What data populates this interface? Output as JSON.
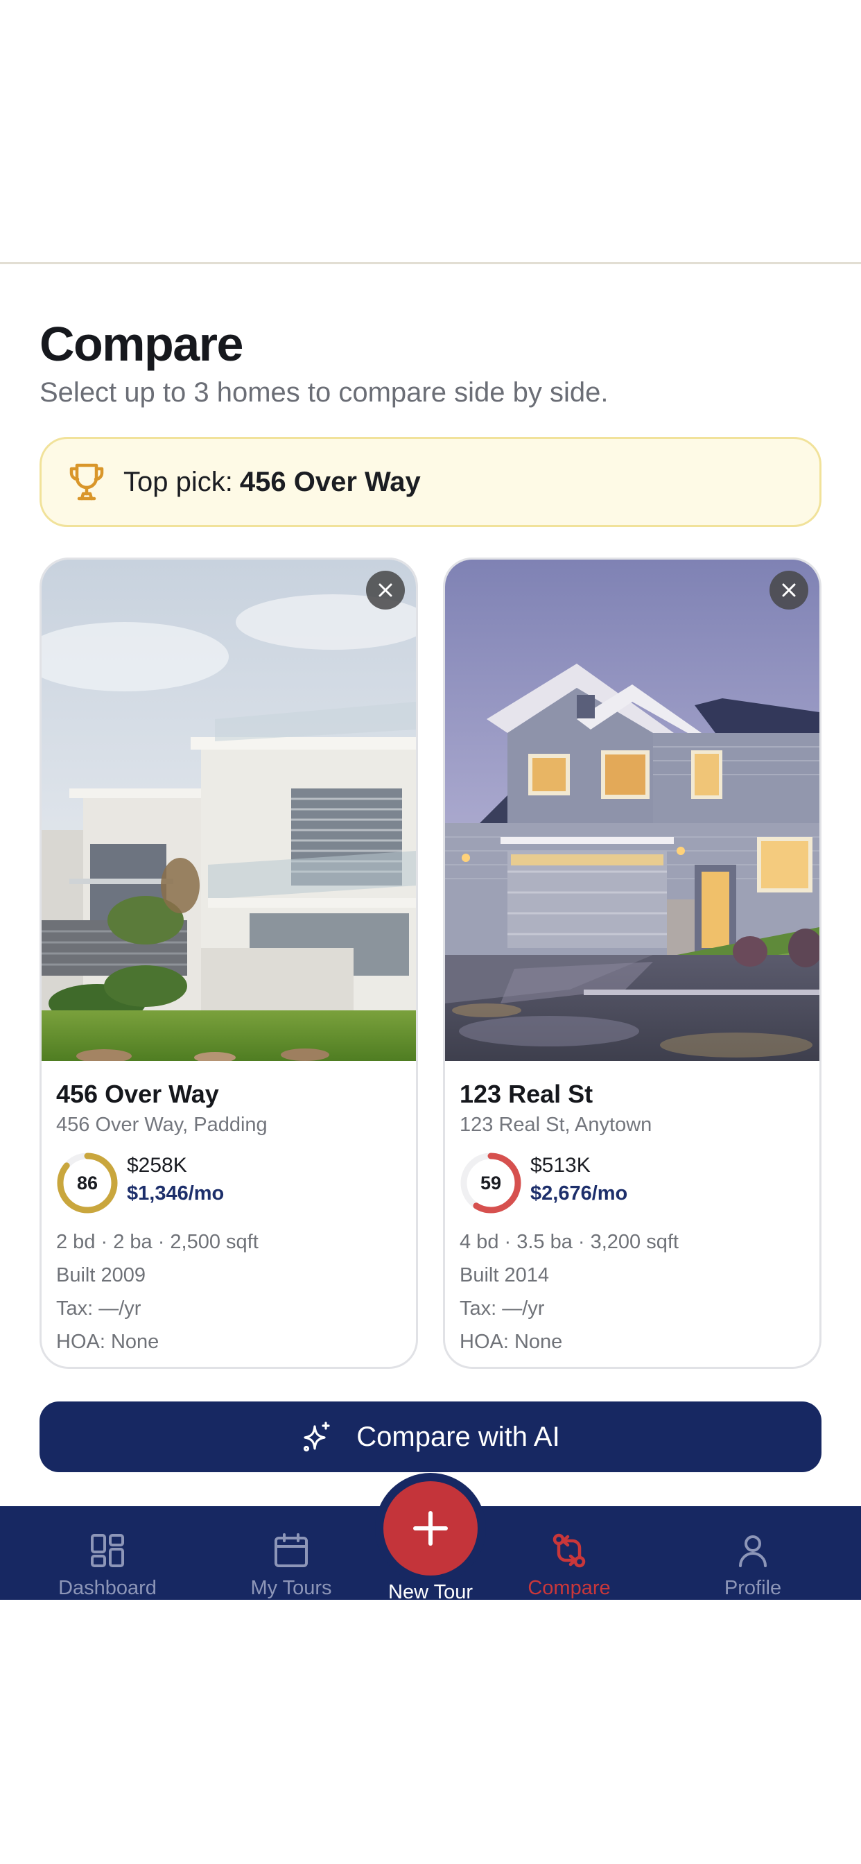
{
  "header": {
    "title": "Compare",
    "subtitle": "Select up to 3 homes to compare side by side."
  },
  "top_pick": {
    "label": "Top pick:",
    "name": "456 Over Way"
  },
  "cards": [
    {
      "name": "456 Over Way",
      "address": "456 Over Way, Padding",
      "score": "86",
      "score_fraction": 0.86,
      "score_color": "#c9a63d",
      "price": "$258K",
      "monthly": "$1,346/mo",
      "specs": "2 bd · 2 ba · 2,500 sqft",
      "built": "Built 2009",
      "tax": "Tax: —/yr",
      "hoa": "HOA: None"
    },
    {
      "name": "123 Real St",
      "address": "123 Real St, Anytown",
      "score": "59",
      "score_fraction": 0.59,
      "score_color": "#d6504e",
      "price": "$513K",
      "monthly": "$2,676/mo",
      "specs": "4 bd · 3.5 ba · 3,200 sqft",
      "built": "Built 2014",
      "tax": "Tax: —/yr",
      "hoa": "HOA: None"
    }
  ],
  "ai_button": {
    "label": "Compare with AI",
    "icon": "sparkle-icon"
  },
  "tabbar": {
    "items": [
      {
        "label": "Dashboard",
        "icon": "dashboard-icon",
        "active": false
      },
      {
        "label": "My Tours",
        "icon": "calendar-icon",
        "active": false
      },
      {
        "label": "New Tour",
        "icon": "plus-icon",
        "active": false
      },
      {
        "label": "Compare",
        "icon": "compare-icon",
        "active": true
      },
      {
        "label": "Profile",
        "icon": "profile-icon",
        "active": false
      }
    ]
  },
  "colors": {
    "navy": "#172862",
    "accent_red": "#c4343a",
    "top_pick_bg": "#fefae6",
    "top_pick_border": "#f1e29a"
  }
}
